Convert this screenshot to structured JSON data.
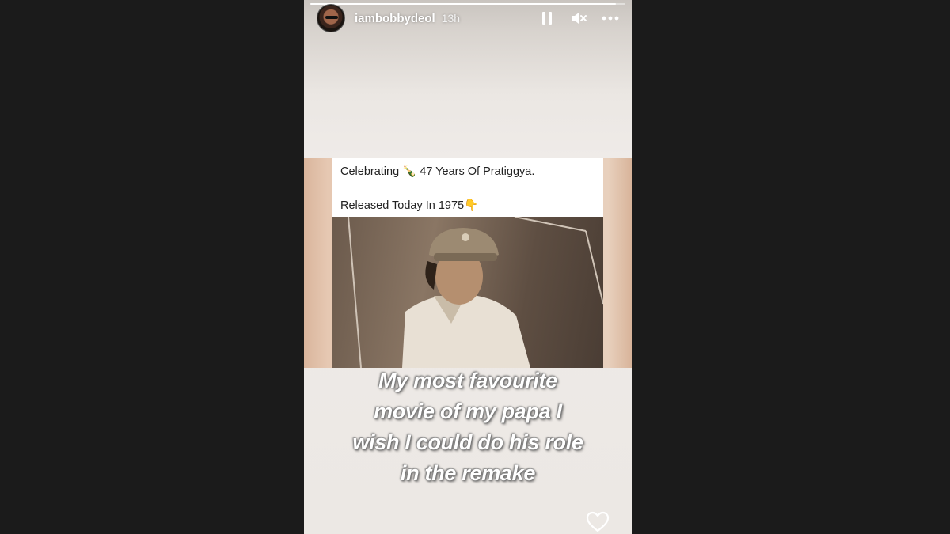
{
  "story": {
    "username": "iambobbydeol",
    "time_ago": "13h",
    "progress": 0.97
  },
  "icons": {
    "pause": "pause-icon",
    "mute": "mute-icon",
    "more": "more-icon",
    "like": "heart-icon"
  },
  "post": {
    "line1": "Celebrating 🍾 47 Years Of Pratiggya.",
    "line2": "Released Today In 1975👇"
  },
  "caption": {
    "line1": "My most favourite",
    "line2": "movie of my papa I",
    "line3": "wish I could do his role",
    "line4": "in the remake"
  }
}
